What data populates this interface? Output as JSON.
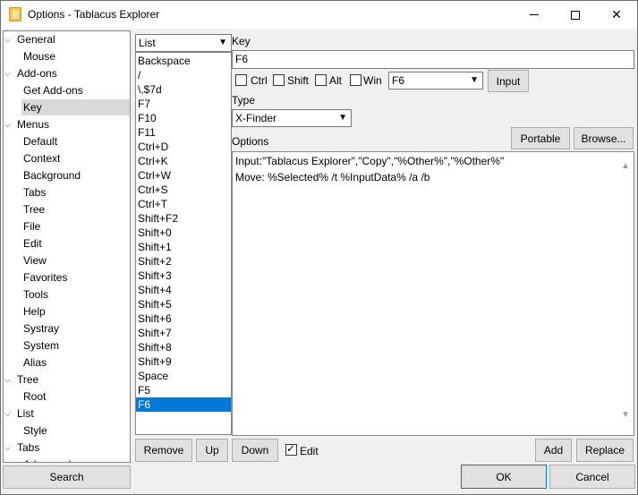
{
  "window": {
    "title": "Options - Tablacus Explorer",
    "minimize": "",
    "maximize": "",
    "close": "✕"
  },
  "tree": {
    "items": [
      {
        "label": "General",
        "level": 0,
        "chevron": "⌵"
      },
      {
        "label": "Mouse",
        "level": 1
      },
      {
        "label": "Add-ons",
        "level": 0,
        "chevron": "⌵"
      },
      {
        "label": "Get Add-ons",
        "level": 1
      },
      {
        "label": "Key",
        "level": 1,
        "selected": true
      },
      {
        "label": "Menus",
        "level": 0,
        "chevron": "⌵"
      },
      {
        "label": "Default",
        "level": 1
      },
      {
        "label": "Context",
        "level": 1
      },
      {
        "label": "Background",
        "level": 1
      },
      {
        "label": "Tabs",
        "level": 1
      },
      {
        "label": "Tree",
        "level": 1
      },
      {
        "label": "File",
        "level": 1
      },
      {
        "label": "Edit",
        "level": 1
      },
      {
        "label": "View",
        "level": 1
      },
      {
        "label": "Favorites",
        "level": 1
      },
      {
        "label": "Tools",
        "level": 1
      },
      {
        "label": "Help",
        "level": 1
      },
      {
        "label": "Systray",
        "level": 1
      },
      {
        "label": "System",
        "level": 1
      },
      {
        "label": "Alias",
        "level": 1
      },
      {
        "label": "Tree",
        "level": 0,
        "chevron": "⌵"
      },
      {
        "label": "Root",
        "level": 1
      },
      {
        "label": "List",
        "level": 0,
        "chevron": "⌵"
      },
      {
        "label": "Style",
        "level": 1
      },
      {
        "label": "Tabs",
        "level": 0,
        "chevron": "⌵"
      },
      {
        "label": "Advanced",
        "level": 1
      }
    ]
  },
  "search_button": "Search",
  "list_select": {
    "value": "List",
    "arrow": "⌵"
  },
  "keys": [
    "Backspace",
    "/",
    "\\,$7d",
    "F7",
    "F10",
    "F11",
    "Ctrl+D",
    "Ctrl+K",
    "Ctrl+W",
    "Ctrl+S",
    "Ctrl+T",
    "Shift+F2",
    "Shift+0",
    "Shift+1",
    "Shift+2",
    "Shift+3",
    "Shift+4",
    "Shift+5",
    "Shift+6",
    "Shift+7",
    "Shift+8",
    "Shift+9",
    "Space",
    "F5",
    "F6"
  ],
  "selected_key_index": 24,
  "key_section": {
    "label": "Key",
    "value": "F6",
    "ctrl_label": "Ctrl",
    "shift_label": "Shift",
    "alt_label": "Alt",
    "win_label": "Win",
    "ctrl_checked": false,
    "shift_checked": false,
    "alt_checked": false,
    "win_checked": false,
    "key_select": "F6",
    "input_button": "Input"
  },
  "type_section": {
    "label": "Type",
    "value": "X-Finder"
  },
  "options_section": {
    "label": "Options",
    "portable_button": "Portable",
    "browse_button": "Browse...",
    "lines": [
      "Input:\"Tablacus Explorer\",\"Copy\",\"%Other%\",\"%Other%\"",
      "Move: %Selected% /t %InputData% /a /b"
    ]
  },
  "bottom": {
    "remove": "Remove",
    "up": "Up",
    "down": "Down",
    "edit_label": "Edit",
    "edit_checked": true,
    "add": "Add",
    "replace": "Replace",
    "ok": "OK",
    "cancel": "Cancel"
  }
}
